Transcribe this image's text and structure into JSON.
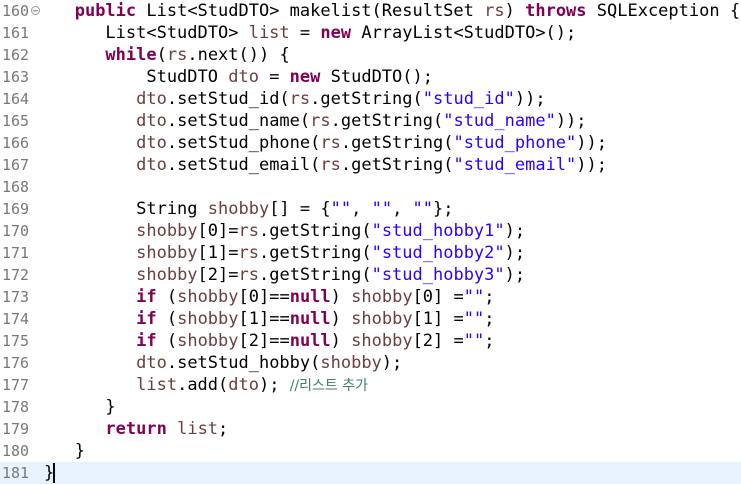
{
  "colors": {
    "keyword": "#7f0055",
    "string": "#2a00ff",
    "comment": "#3f7f5f",
    "local_variable": "#6a3e3e",
    "line_number": "#787878",
    "current_line_bg": "#e8f2fe"
  },
  "editor": {
    "fold_icon": "minus-circle-icon",
    "lines": [
      {
        "no": "160",
        "code": "   public List<StudDTO> makelist(ResultSet rs) throws SQLException {"
      },
      {
        "no": "161",
        "code": "      List<StudDTO> list = new ArrayList<StudDTO>();"
      },
      {
        "no": "162",
        "code": "      while(rs.next()) {"
      },
      {
        "no": "163",
        "code": "          StudDTO dto = new StudDTO();"
      },
      {
        "no": "164",
        "code": "         dto.setStud_id(rs.getString(\"stud_id\"));"
      },
      {
        "no": "165",
        "code": "         dto.setStud_name(rs.getString(\"stud_name\"));"
      },
      {
        "no": "166",
        "code": "         dto.setStud_phone(rs.getString(\"stud_phone\"));"
      },
      {
        "no": "167",
        "code": "         dto.setStud_email(rs.getString(\"stud_email\"));"
      },
      {
        "no": "168",
        "code": ""
      },
      {
        "no": "169",
        "code": "         String shobby[] = {\"\", \"\", \"\"};"
      },
      {
        "no": "170",
        "code": "         shobby[0]=rs.getString(\"stud_hobby1\");"
      },
      {
        "no": "171",
        "code": "         shobby[1]=rs.getString(\"stud_hobby2\");"
      },
      {
        "no": "172",
        "code": "         shobby[2]=rs.getString(\"stud_hobby3\");"
      },
      {
        "no": "173",
        "code": "         if (shobby[0]==null) shobby[0] =\"\";"
      },
      {
        "no": "174",
        "code": "         if (shobby[1]==null) shobby[1] =\"\";"
      },
      {
        "no": "175",
        "code": "         if (shobby[2]==null) shobby[2] =\"\";"
      },
      {
        "no": "176",
        "code": "         dto.setStud_hobby(shobby);"
      },
      {
        "no": "177",
        "code": "         list.add(dto); //리스트 추가"
      },
      {
        "no": "178",
        "code": "      }"
      },
      {
        "no": "179",
        "code": "      return list;"
      },
      {
        "no": "180",
        "code": "   }"
      },
      {
        "no": "181",
        "code": "}"
      }
    ],
    "current_line": 21
  }
}
